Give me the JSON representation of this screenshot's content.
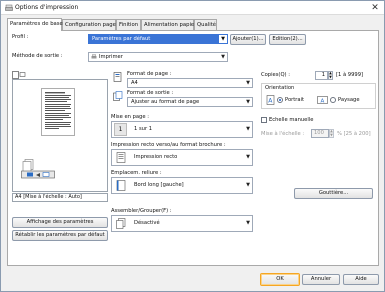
{
  "window": {
    "title": "Options d'impression",
    "close_glyph": "✕"
  },
  "tabs": [
    "Paramètres de base",
    "Configuration page",
    "Finition",
    "Alimentation papier",
    "Qualité"
  ],
  "profile": {
    "label": "Profil :",
    "value": "Paramètres par défaut",
    "add_button": "Ajouter(1)...",
    "edit_button": "Edition(2)..."
  },
  "output_method": {
    "label": "Méthode de sortie :",
    "value": "Imprimer"
  },
  "preview": {
    "status": "A4 [Mise à l'échelle : Auto]"
  },
  "page_size": {
    "label": "Format de page :",
    "value": "A4"
  },
  "output_size": {
    "label": "Format de sortie :",
    "value": "Ajuster au format de page"
  },
  "copies": {
    "label": "Copies(Q) :",
    "value": "1",
    "range": "[1 à 9999]"
  },
  "orientation": {
    "label": "Orientation",
    "portrait": "Portrait",
    "landscape": "Paysage",
    "selected": "portrait"
  },
  "layout": {
    "label": "Mise en page :",
    "value": "1 sur 1",
    "number": "1"
  },
  "manual_scaling": {
    "label": "Echelle manuelle",
    "scale_label": "Mise à l'échelle :",
    "scale_value": "100",
    "scale_range": "% [25 à 200]"
  },
  "duplex": {
    "label": "Impression recto verso/au format brochure :",
    "value": "Impression recto"
  },
  "binding": {
    "label": "Emplacem. reliure :",
    "value": "Bord long [gauche]"
  },
  "gutter_button": "Gouttière...",
  "collate": {
    "label": "Assembler/Grouper(F) :",
    "value": "Désactivé"
  },
  "left_buttons": {
    "view_settings": "Affichage des paramètres",
    "restore_defaults": "Rétablir les paramètres par défaut"
  },
  "footer": {
    "ok": "OK",
    "cancel": "Annuler",
    "help": "Aide"
  },
  "colors": {
    "accent": "#3a74d6",
    "ok_highlight": "#f5a623"
  }
}
